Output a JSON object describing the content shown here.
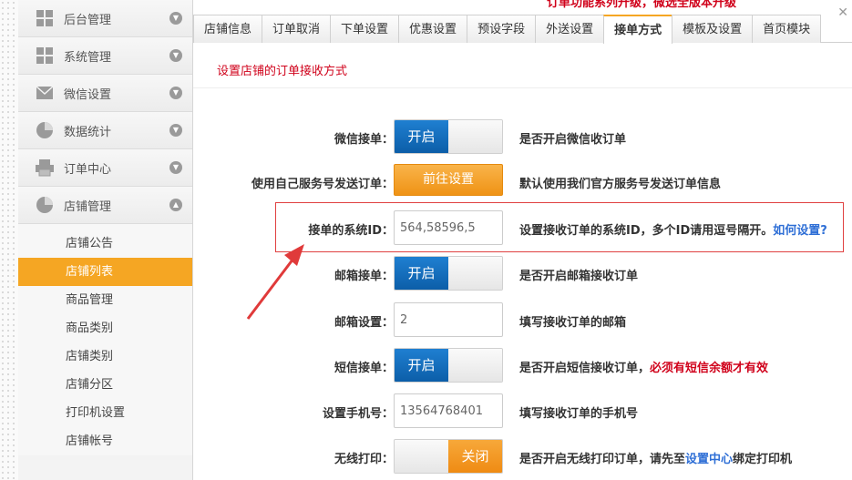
{
  "notice": "订单功能系列升级，微选全版本升级",
  "sidebar": {
    "menus": [
      {
        "label": "后台管理",
        "icon": "grid-icon"
      },
      {
        "label": "系统管理",
        "icon": "grid-icon"
      },
      {
        "label": "微信设置",
        "icon": "mail-icon"
      },
      {
        "label": "数据统计",
        "icon": "pie-chart-icon"
      },
      {
        "label": "订单中心",
        "icon": "printer-icon"
      },
      {
        "label": "店铺管理",
        "icon": "pie-chart-icon"
      }
    ],
    "submenu": [
      "店铺公告",
      "店铺列表",
      "商品管理",
      "商品类别",
      "店铺类别",
      "店铺分区",
      "打印机设置",
      "店铺帐号"
    ],
    "active_submenu": "店铺列表"
  },
  "tabs": [
    "店铺信息",
    "订单取消",
    "下单设置",
    "优惠设置",
    "预设字段",
    "外送设置",
    "接单方式",
    "模板及设置",
    "首页模块"
  ],
  "active_tab": "接单方式",
  "section_title": "设置店铺的订单接收方式",
  "form": {
    "wechat": {
      "label": "微信接单：",
      "state": "开启",
      "desc": "是否开启微信收订单"
    },
    "own_service": {
      "label": "使用自己服务号发送订单：",
      "button": "前往设置",
      "desc": "默认使用我们官方服务号发送订单信息"
    },
    "system_id": {
      "label": "接单的系统ID：",
      "value": "564,58596,5",
      "desc": "设置接收订单的系统ID，多个ID请用逗号隔开。",
      "link": "如何设置?"
    },
    "email": {
      "label": "邮箱接单：",
      "state": "开启",
      "desc": "是否开启邮箱接收订单"
    },
    "email_setting": {
      "label": "邮箱设置：",
      "value": "2",
      "desc": "填写接收订单的邮箱"
    },
    "sms": {
      "label": "短信接单：",
      "state": "开启",
      "desc": "是否开启短信接收订单，",
      "warn": "必须有短信余额才有效"
    },
    "phone": {
      "label": "设置手机号：",
      "value": "13564768401",
      "desc": "填写接收订单的手机号"
    },
    "wireless_print": {
      "label": "无线打印：",
      "state": "关闭",
      "desc_pre": "是否开启无线打印订单，请先至",
      "link": "设置中心",
      "desc_post": "绑定打印机"
    }
  },
  "colors": {
    "accent": "#f5a623",
    "toggle_on": "#1170c4",
    "warn": "#d0021b",
    "link": "#2f6fd6"
  }
}
